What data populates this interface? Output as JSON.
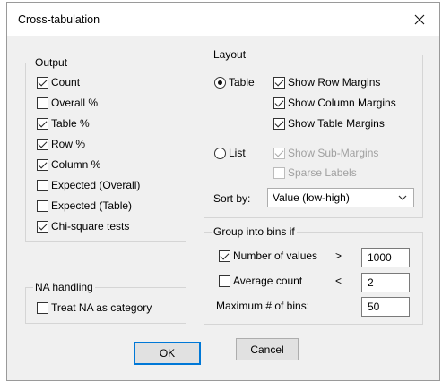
{
  "window": {
    "title": "Cross-tabulation"
  },
  "output": {
    "label": "Output",
    "items": [
      {
        "label": "Count",
        "checked": true
      },
      {
        "label": "Overall %",
        "checked": false
      },
      {
        "label": "Table %",
        "checked": true
      },
      {
        "label": "Row %",
        "checked": true
      },
      {
        "label": "Column %",
        "checked": true
      },
      {
        "label": "Expected (Overall)",
        "checked": false
      },
      {
        "label": "Expected (Table)",
        "checked": false
      },
      {
        "label": "Chi-square tests",
        "checked": true
      }
    ]
  },
  "na_handling": {
    "label": "NA handling",
    "treat_na": {
      "label": "Treat NA as category",
      "checked": false
    }
  },
  "layout": {
    "label": "Layout",
    "table_radio": {
      "label": "Table",
      "selected": true
    },
    "show_row_margins": {
      "label": "Show Row Margins",
      "checked": true
    },
    "show_column_margins": {
      "label": "Show Column Margins",
      "checked": true
    },
    "show_table_margins": {
      "label": "Show Table Margins",
      "checked": true
    },
    "list_radio": {
      "label": "List",
      "selected": false
    },
    "show_sub_margins": {
      "label": "Show Sub-Margins",
      "checked": true,
      "disabled": true
    },
    "sparse_labels": {
      "label": "Sparse Labels",
      "checked": false,
      "disabled": true
    },
    "sort_by": {
      "label": "Sort by:",
      "value": "Value (low-high)"
    }
  },
  "bins": {
    "label": "Group into bins if",
    "number_of_values": {
      "label": "Number of values",
      "operator": ">",
      "value": "1000",
      "checked": true
    },
    "average_count": {
      "label": "Average count",
      "operator": "<",
      "value": "2",
      "checked": false
    },
    "max_bins": {
      "label": "Maximum # of bins:",
      "value": "50"
    }
  },
  "buttons": {
    "ok": "OK",
    "cancel": "Cancel"
  },
  "icons": {
    "close": "close-icon",
    "dropdown": "chevron-down-icon"
  },
  "colors": {
    "accent": "#0078d7",
    "dialog_bg": "#f0f0f0"
  }
}
